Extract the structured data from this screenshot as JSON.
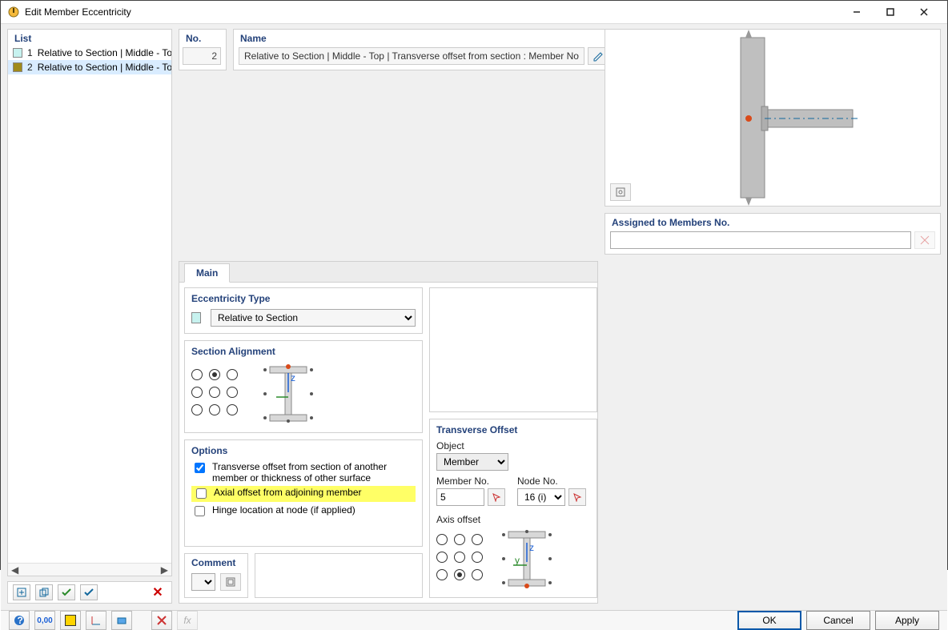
{
  "window": {
    "title": "Edit Member Eccentricity"
  },
  "list": {
    "header": "List",
    "items": [
      {
        "num": "1",
        "color": "#c7f2ef",
        "text": "Relative to Section | Middle - To",
        "selected": false
      },
      {
        "num": "2",
        "color": "#a08a1a",
        "text": "Relative to Section | Middle - To",
        "selected": true
      }
    ]
  },
  "fields": {
    "no_label": "No.",
    "no_value": "2",
    "name_label": "Name",
    "name_value": "Relative to Section | Middle - Top | Transverse offset from section : Member No",
    "assigned_label": "Assigned to Members No."
  },
  "tabs": {
    "main": "Main"
  },
  "ecc_type": {
    "label": "Eccentricity Type",
    "value": "Relative to Section"
  },
  "section_alignment": {
    "label": "Section Alignment",
    "selected_index": 1
  },
  "options": {
    "label": "Options",
    "transverse": "Transverse offset from section of another member or thickness of other surface",
    "transverse_checked": true,
    "axial": "Axial offset from adjoining member",
    "axial_checked": false,
    "hinge": "Hinge location at node (if applied)",
    "hinge_checked": false
  },
  "transverse": {
    "label": "Transverse Offset",
    "object_label": "Object",
    "object_value": "Member",
    "member_label": "Member No.",
    "member_value": "5",
    "node_label": "Node No.",
    "node_value": "16 (i)",
    "axis_label": "Axis offset",
    "axis_selected_index": 7
  },
  "comment": {
    "label": "Comment"
  },
  "buttons": {
    "ok": "OK",
    "cancel": "Cancel",
    "apply": "Apply"
  }
}
